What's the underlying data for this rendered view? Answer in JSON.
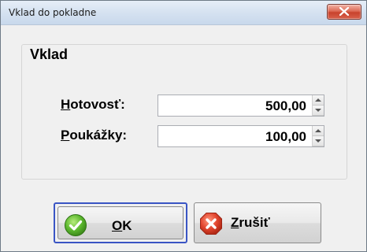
{
  "window": {
    "title": "Vklad do pokladne"
  },
  "group": {
    "title": "Vklad"
  },
  "fields": [
    {
      "mnemonic": "H",
      "label_rest": "otovosť:",
      "value": "500,00"
    },
    {
      "mnemonic": "P",
      "label_rest": "oukážky:",
      "value": "100,00"
    }
  ],
  "buttons": {
    "ok": {
      "mnemonic": "O",
      "label_rest": "K",
      "icon": "check-icon"
    },
    "cancel": {
      "mnemonic": "Z",
      "label_rest": "rušiť",
      "icon": "close-icon"
    }
  },
  "colors": {
    "focus_border": "#3a55c4",
    "ok_icon": "#5cb82e",
    "cancel_icon": "#e2452e",
    "close_button": "#c8432d"
  }
}
